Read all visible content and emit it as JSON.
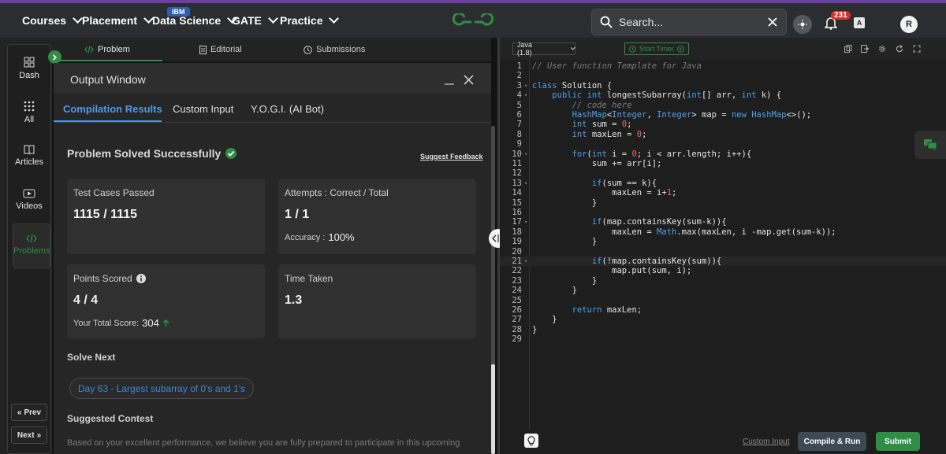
{
  "nav": {
    "items": [
      {
        "label": "Courses"
      },
      {
        "label": "Placement"
      },
      {
        "label": "Data Science"
      },
      {
        "label": "GATE"
      },
      {
        "label": "Practice"
      }
    ],
    "ibm_badge": "IBM"
  },
  "search": {
    "placeholder": "Search..."
  },
  "notifications": {
    "count": "231"
  },
  "user": {
    "initial": "R"
  },
  "rail": {
    "dash": "Dash",
    "all": "All",
    "articles": "Articles",
    "videos": "Videos",
    "problems": "Problems",
    "prev": "Prev",
    "next": "Next"
  },
  "problem_tabs": {
    "problem": "Problem",
    "editorial": "Editorial",
    "submissions": "Submissions"
  },
  "output": {
    "title": "Output Window",
    "tabs": {
      "compilation": "Compilation Results",
      "custom": "Custom Input",
      "yogi": "Y.O.G.I. (AI Bot)"
    },
    "status": "Problem Solved Successfully",
    "feedback": "Suggest Feedback",
    "cards": {
      "tests_label": "Test Cases Passed",
      "tests_value": "1115 / 1115",
      "attempts_label": "Attempts : Correct / Total",
      "attempts_value": "1 / 1",
      "accuracy_label": "Accuracy :",
      "accuracy_value": "100%",
      "points_label": "Points Scored",
      "points_value": "4 / 4",
      "total_label": "Your Total Score:",
      "total_value": "304",
      "time_label": "Time Taken",
      "time_value": "1.3"
    },
    "solve_next_heading": "Solve Next",
    "solve_next_item": "Day 63 - Largest subarray of 0's and 1's",
    "suggested_contest_heading": "Suggested Contest",
    "suggested_contest_text": "Based on your excellent performance, we believe you are fully prepared to participate in this upcoming"
  },
  "editor": {
    "language": "Java (1.8)",
    "timer": "Start Timer",
    "custom_input": "Custom Input",
    "compile": "Compile & Run",
    "submit": "Submit",
    "lines": [
      "// User function Template for Java",
      "",
      "class Solution {",
      "    public int longestSubarray(int[] arr, int k) {",
      "        // code here",
      "        HashMap<Integer, Integer> map = new HashMap<>();",
      "        int sum = 0;",
      "        int maxLen = 0;",
      "",
      "        for(int i = 0; i < arr.length; i++){",
      "            sum += arr[i];",
      "",
      "            if(sum == k){",
      "                maxLen = i+1;",
      "            }",
      "",
      "            if(map.containsKey(sum-k)){",
      "                maxLen = Math.max(maxLen, i -map.get(sum-k));",
      "            }",
      "",
      "            if(!map.containsKey(sum)){",
      "                map.put(sum, i);",
      "            }",
      "        }",
      "",
      "        return maxLen;",
      "    }",
      "}",
      ""
    ]
  }
}
